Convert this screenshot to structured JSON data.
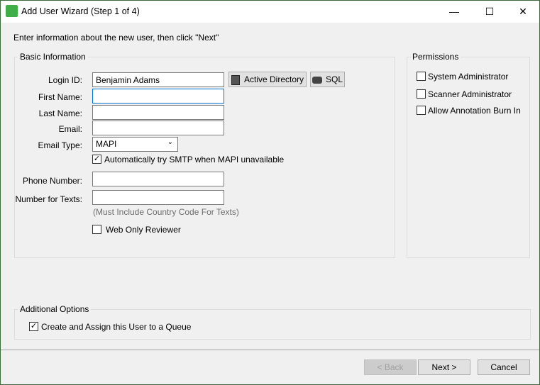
{
  "window": {
    "title": "Add User Wizard (Step 1 of 4)",
    "minimize": "—",
    "maximize": "☐",
    "close": "✕"
  },
  "instruction": "Enter information about the new user, then click \"Next\"",
  "basic": {
    "label": "Basic Information",
    "login_label": "Login ID:",
    "login_value": "Benjamin Adams",
    "active_directory": "Active Directory",
    "sql": "SQL",
    "first_label": "First Name:",
    "first_value": "",
    "last_label": "Last Name:",
    "last_value": "",
    "email_label": "Email:",
    "email_value": "",
    "email_type_label": "Email Type:",
    "email_type_value": "MAPI",
    "smtp_label": "Automatically try SMTP when MAPI unavailable",
    "smtp_checked": true,
    "phone_label": "Phone Number:",
    "phone_value": "",
    "texts_label": "Number for Texts:",
    "texts_value": "",
    "texts_hint": "(Must Include Country Code For Texts)",
    "web_only_label": "Web Only Reviewer",
    "web_only_checked": false
  },
  "permissions": {
    "label": "Permissions",
    "items": [
      {
        "label": "System Administrator",
        "checked": false
      },
      {
        "label": "Scanner Administrator",
        "checked": false
      },
      {
        "label": "Allow Annotation Burn In",
        "checked": false
      }
    ]
  },
  "additional": {
    "label": "Additional Options",
    "queue_label": "Create and Assign this User to a Queue",
    "queue_checked": true
  },
  "buttons": {
    "back": "< Back",
    "next": "Next >",
    "cancel": "Cancel"
  },
  "check_glyph": "✓"
}
